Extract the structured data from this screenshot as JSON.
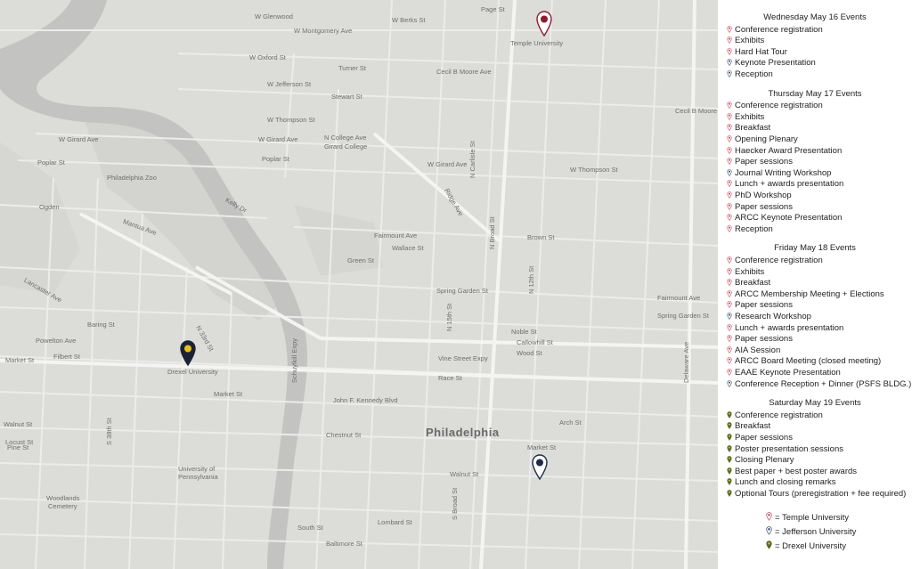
{
  "map": {
    "city_label": "Philadelphia",
    "pins": [
      {
        "name": "Temple University",
        "color": "#8a1c2e"
      },
      {
        "name": "Jefferson University",
        "color": "#1f2b4a"
      },
      {
        "name": "Drexel University",
        "color": "#e6c21a"
      }
    ],
    "poi_labels": {
      "temple": "Temple University",
      "drexel": "Drexel University",
      "upenn1": "University of",
      "upenn2": "Pennsylvania",
      "zoo": "Philadelphia Zoo",
      "woodlands1": "Woodlands",
      "woodlands2": "Cemetery",
      "girard_college": "Girard College"
    },
    "streets": {
      "w_montgomery": "W Montgomery Ave",
      "w_oxford": "W Oxford St",
      "w_jefferson": "W Jefferson St",
      "w_thompson": "W Thompson St",
      "w_girard": "W Girard Ave",
      "w_girard2": "W Girard Ave",
      "w_girard3": "W Girard Ave",
      "poplar1": "Poplar St",
      "poplar2": "Poplar St",
      "fairmount": "Fairmount Ave",
      "spring_garden": "Spring Garden St",
      "spring_garden2": "Spring Garden St",
      "vine": "Vine Street Expy",
      "race": "Race St",
      "market": "Market St",
      "market2": "Market St",
      "market3": "Market St",
      "jfk": "John F. Kennedy Blvd",
      "chestnut": "Chestnut St",
      "walnut": "Walnut St",
      "walnut2": "Walnut St",
      "locust": "Locust St",
      "pine": "Pine St",
      "lombard": "Lombard St",
      "south": "South St",
      "baltimore": "Baltimore St",
      "n_broad": "N Broad St",
      "s_broad": "S Broad St",
      "cecil": "Cecil B Moore Ave",
      "cecil2": "Cecil B Moore Ave",
      "ridge": "Ridge Ave",
      "lancaster": "Lancaster Ave",
      "powelton": "Powelton Ave",
      "filbert": "Filbert St",
      "baring": "Baring St",
      "arch": "Arch St",
      "kelly": "Kelly Dr",
      "brown": "Brown St",
      "green": "Green St",
      "wallace": "Wallace St",
      "callowhill": "Callowhill St",
      "wood": "Wood St",
      "noble": "Noble St",
      "n33": "N 33rd St",
      "n15": "N 15th St",
      "s38": "S 38th St",
      "ogden": "Ogden",
      "mantua": "Mantua Ave",
      "berks": "W Berks St",
      "page": "Page St",
      "w_glenwood": "W Glenwood",
      "college": "N College Ave",
      "turner": "Turner St",
      "stewart": "Stewart St",
      "w_thompson2": "W Thompson St",
      "delaware": "Delaware Ave",
      "fairmount2": "Fairmount Ave",
      "schuylkill": "Schuylkill Expy",
      "n_carlisle": "N Carlisle St",
      "n_12": "N 12th St"
    }
  },
  "legend": {
    "days": [
      {
        "title": "Wednesday May 16 Events",
        "events": [
          {
            "label": "Conference registration",
            "venue": "temple"
          },
          {
            "label": "Exhibits",
            "venue": "temple"
          },
          {
            "label": "Hard Hat Tour",
            "venue": "temple"
          },
          {
            "label": "Keynote Presentation",
            "venue": "jefferson"
          },
          {
            "label": "Reception",
            "venue": "jefferson"
          }
        ]
      },
      {
        "title": "Thursday May 17 Events",
        "events": [
          {
            "label": "Conference registration",
            "venue": "temple"
          },
          {
            "label": "Exhibits",
            "venue": "temple"
          },
          {
            "label": "Breakfast",
            "venue": "temple"
          },
          {
            "label": "Opening Plenary",
            "venue": "temple"
          },
          {
            "label": "Haecker Award Presentation",
            "venue": "temple"
          },
          {
            "label": "Paper sessions",
            "venue": "temple"
          },
          {
            "label": "Journal Writing Workshop",
            "venue": "jefferson"
          },
          {
            "label": "Lunch + awards presentation",
            "venue": "temple"
          },
          {
            "label": "PhD Workshop",
            "venue": "temple"
          },
          {
            "label": "Paper sessions",
            "venue": "temple"
          },
          {
            "label": "ARCC Keynote Presentation",
            "venue": "temple"
          },
          {
            "label": "Reception",
            "venue": "temple"
          }
        ]
      },
      {
        "title": "Friday May 18 Events",
        "events": [
          {
            "label": "Conference registration",
            "venue": "temple"
          },
          {
            "label": "Exhibits",
            "venue": "temple"
          },
          {
            "label": "Breakfast",
            "venue": "temple"
          },
          {
            "label": "ARCC Membership Meeting + Elections",
            "venue": "temple"
          },
          {
            "label": "Paper sessions",
            "venue": "temple"
          },
          {
            "label": "Research Workshop",
            "venue": "jefferson"
          },
          {
            "label": "Lunch + awards presentation",
            "venue": "temple"
          },
          {
            "label": "Paper sessions",
            "venue": "temple"
          },
          {
            "label": "AIA Session",
            "venue": "temple"
          },
          {
            "label": "ARCC Board Meeting (closed meeting)",
            "venue": "temple"
          },
          {
            "label": "EAAE Keynote Presentation",
            "venue": "temple"
          },
          {
            "label": "Conference Reception + Dinner (PSFS BLDG.)",
            "venue": "jefferson"
          }
        ]
      },
      {
        "title": "Saturday May 19 Events",
        "events": [
          {
            "label": "Conference registration",
            "venue": "drexel"
          },
          {
            "label": "Breakfast",
            "venue": "drexel"
          },
          {
            "label": "Paper sessions",
            "venue": "drexel"
          },
          {
            "label": "Poster presentation sessions",
            "venue": "drexel"
          },
          {
            "label": "Closing Plenary",
            "venue": "drexel"
          },
          {
            "label": "Best paper + best poster awards",
            "venue": "drexel"
          },
          {
            "label": "Lunch and closing remarks",
            "venue": "drexel"
          },
          {
            "label": "Optional Tours (preregistration + fee required)",
            "venue": "drexel"
          }
        ]
      }
    ],
    "key": [
      {
        "venue": "temple",
        "label": "= Temple University"
      },
      {
        "venue": "jefferson",
        "label": "= Jefferson University"
      },
      {
        "venue": "drexel",
        "label": "= Drexel University"
      }
    ],
    "venue_colors": {
      "temple": "#c0314a",
      "jefferson": "#2a3760",
      "drexel": "#566b2a"
    }
  }
}
